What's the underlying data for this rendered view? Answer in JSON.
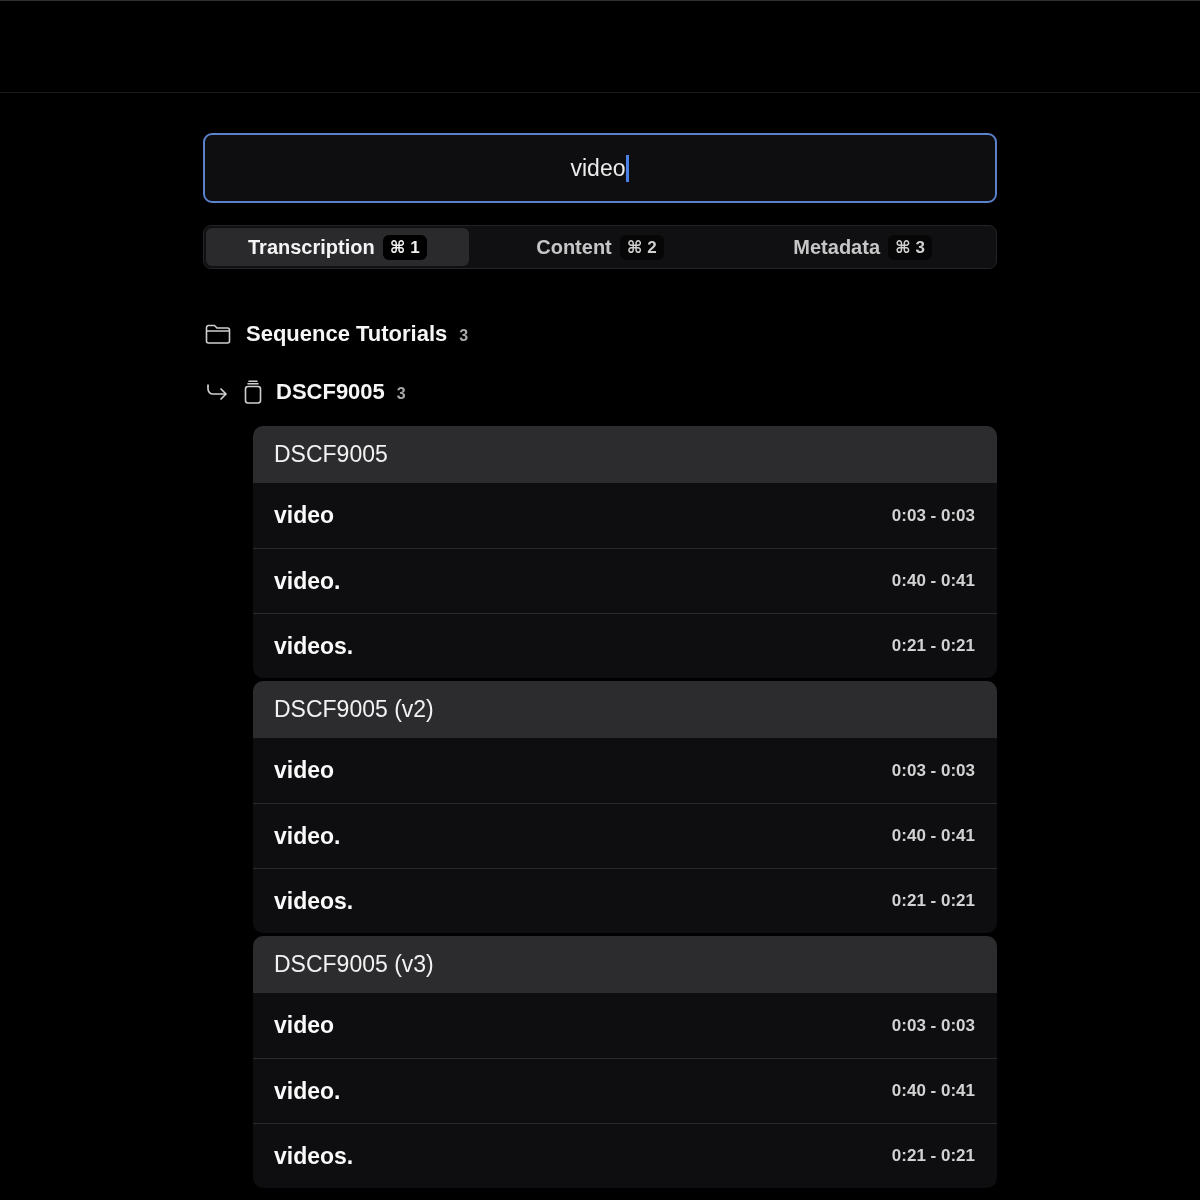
{
  "search": {
    "value": "video",
    "focused": true
  },
  "tabs": [
    {
      "label": "Transcription",
      "shortcut": "⌘ 1",
      "selected": true
    },
    {
      "label": "Content",
      "shortcut": "⌘ 2",
      "selected": false
    },
    {
      "label": "Metadata",
      "shortcut": "⌘ 3",
      "selected": false
    }
  ],
  "folder": {
    "name": "Sequence Tutorials",
    "count": "3"
  },
  "clip": {
    "name": "DSCF9005",
    "count": "3"
  },
  "groups": [
    {
      "title": "DSCF9005",
      "results": [
        {
          "text": "video",
          "time": "0:03 - 0:03"
        },
        {
          "text": "video.",
          "time": "0:40 - 0:41"
        },
        {
          "text": "videos.",
          "time": "0:21 - 0:21"
        }
      ]
    },
    {
      "title": "DSCF9005 (v2)",
      "results": [
        {
          "text": "video",
          "time": "0:03 - 0:03"
        },
        {
          "text": "video.",
          "time": "0:40 - 0:41"
        },
        {
          "text": "videos.",
          "time": "0:21 - 0:21"
        }
      ]
    },
    {
      "title": "DSCF9005 (v3)",
      "results": [
        {
          "text": "video",
          "time": "0:03 - 0:03"
        },
        {
          "text": "video.",
          "time": "0:40 - 0:41"
        },
        {
          "text": "videos.",
          "time": "0:21 - 0:21"
        }
      ]
    }
  ]
}
